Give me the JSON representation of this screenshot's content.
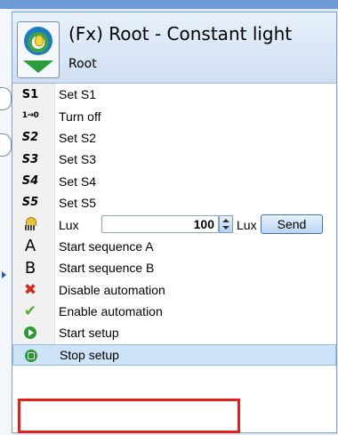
{
  "header": {
    "title": "(Fx) Root - Constant light",
    "subtitle": "Root",
    "icon": "bulb-settings-icon"
  },
  "menu": {
    "items": [
      {
        "icon_text": "S1",
        "icon": "s1-icon",
        "label": "Set S1"
      },
      {
        "icon_text": "1→0",
        "icon": "turn-off-icon",
        "label": "Turn off"
      },
      {
        "icon_text": "S2",
        "icon": "s2-icon",
        "label": "Set S2"
      },
      {
        "icon_text": "S3",
        "icon": "s3-icon",
        "label": "Set S3"
      },
      {
        "icon_text": "S4",
        "icon": "s4-icon",
        "label": "Set S4"
      },
      {
        "icon_text": "S5",
        "icon": "s5-icon",
        "label": "Set S5"
      }
    ],
    "lux": {
      "label": "Lux",
      "value": "100",
      "unit": "Lux",
      "send_label": "Send"
    },
    "items2": [
      {
        "icon_text": "A",
        "icon": "letter-a-icon",
        "label": "Start sequence A"
      },
      {
        "icon_text": "B",
        "icon": "letter-b-icon",
        "label": "Start sequence B"
      },
      {
        "icon_text": "✖",
        "icon": "red-x-icon",
        "label": "Disable automation"
      },
      {
        "icon_text": "✔",
        "icon": "green-check-icon",
        "label": "Enable automation"
      },
      {
        "icon": "play-circle-icon",
        "label": "Start setup"
      },
      {
        "icon": "stop-circle-icon",
        "label": "Stop setup",
        "selected": true
      }
    ]
  },
  "colors": {
    "highlight": "#e2201c",
    "selection": "#cde3f7",
    "accent": "#2b9a34"
  }
}
